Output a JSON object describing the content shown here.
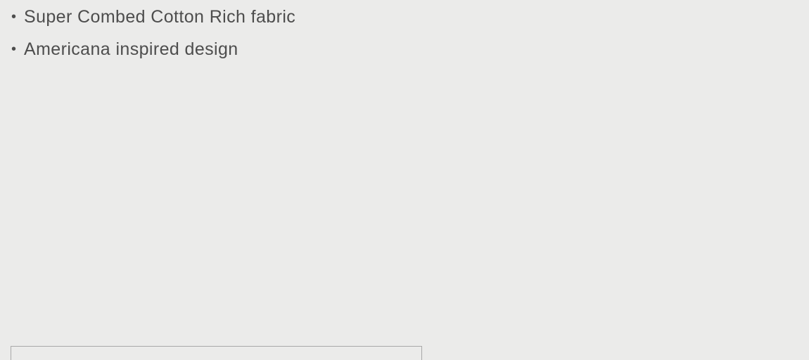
{
  "features": {
    "bullet": "•",
    "items": [
      "Super Combed Cotton Rich fabric",
      "Americana inspired design"
    ]
  }
}
